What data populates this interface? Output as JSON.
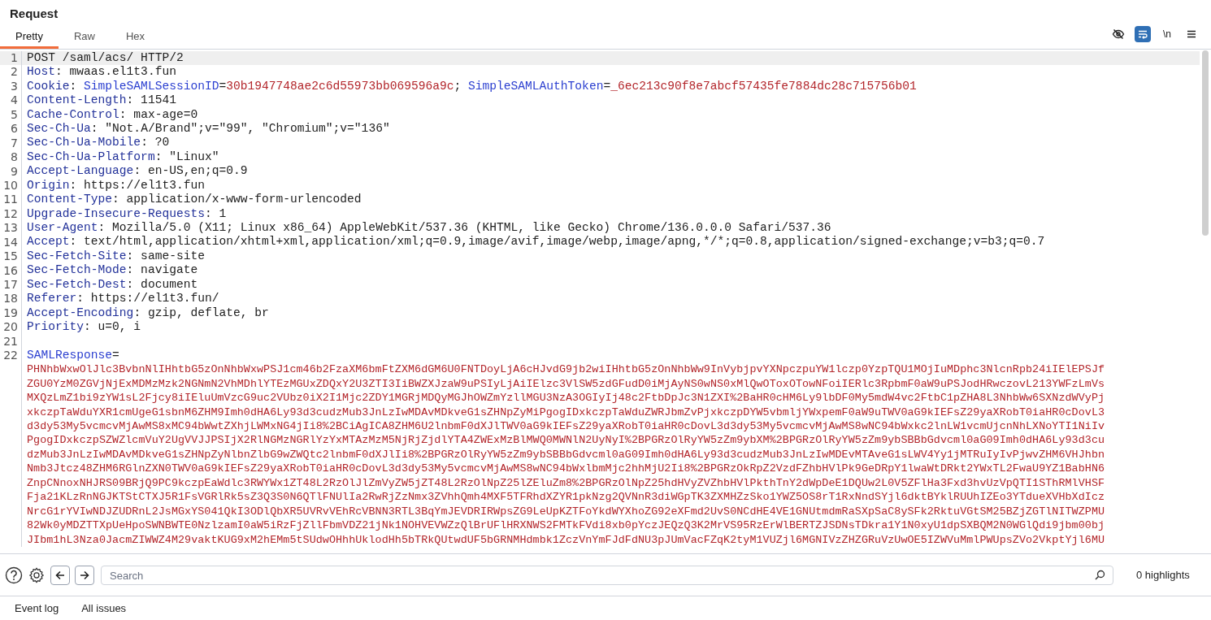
{
  "panel": {
    "title": "Request"
  },
  "tabs": [
    {
      "label": "Pretty",
      "selected": true
    },
    {
      "label": "Raw",
      "selected": false
    },
    {
      "label": "Hex",
      "selected": false
    }
  ],
  "toolbar": [
    {
      "kind": "hide",
      "selected": false
    },
    {
      "kind": "wrap",
      "selected": true
    },
    {
      "kind": "newline",
      "label": "\\n",
      "selected": false
    },
    {
      "kind": "menu",
      "selected": false
    }
  ],
  "editor": {
    "lines": [
      {
        "number": "1",
        "selected": true,
        "segments": [
          {
            "kind": "plain",
            "text": "POST /saml/acs/ HTTP/2"
          }
        ]
      },
      {
        "number": "2",
        "selected": false,
        "segments": [
          {
            "kind": "key",
            "text": "Host"
          },
          {
            "kind": "plain",
            "text": ": mwaas.el1t3.fun"
          }
        ]
      },
      {
        "number": "3",
        "selected": false,
        "segments": [
          {
            "kind": "key",
            "text": "Cookie"
          },
          {
            "kind": "plain",
            "text": ": "
          },
          {
            "kind": "cookie_name",
            "text": "SimpleSAMLSessionID"
          },
          {
            "kind": "plain",
            "text": "="
          },
          {
            "kind": "cookie_value",
            "text": "30b1947748ae2c6d55973bb069596a9c"
          },
          {
            "kind": "plain",
            "text": "; "
          },
          {
            "kind": "cookie_name",
            "text": "SimpleSAMLAuthToken"
          },
          {
            "kind": "plain",
            "text": "="
          },
          {
            "kind": "cookie_value",
            "text": "_6ec213c90f8e7abcf57435fe7884dc28c715756b01"
          }
        ]
      },
      {
        "number": "4",
        "selected": false,
        "segments": [
          {
            "kind": "key",
            "text": "Content-Length"
          },
          {
            "kind": "plain",
            "text": ": 11541"
          }
        ]
      },
      {
        "number": "5",
        "selected": false,
        "segments": [
          {
            "kind": "key",
            "text": "Cache-Control"
          },
          {
            "kind": "plain",
            "text": ": max-age=0"
          }
        ]
      },
      {
        "number": "6",
        "selected": false,
        "segments": [
          {
            "kind": "key",
            "text": "Sec-Ch-Ua"
          },
          {
            "kind": "plain",
            "text": ": \"Not.A/Brand\";v=\"99\", \"Chromium\";v=\"136\""
          }
        ]
      },
      {
        "number": "7",
        "selected": false,
        "segments": [
          {
            "kind": "key",
            "text": "Sec-Ch-Ua-Mobile"
          },
          {
            "kind": "plain",
            "text": ": ?0"
          }
        ]
      },
      {
        "number": "8",
        "selected": false,
        "segments": [
          {
            "kind": "key",
            "text": "Sec-Ch-Ua-Platform"
          },
          {
            "kind": "plain",
            "text": ": \"Linux\""
          }
        ]
      },
      {
        "number": "9",
        "selected": false,
        "segments": [
          {
            "kind": "key",
            "text": "Accept-Language"
          },
          {
            "kind": "plain",
            "text": ": en-US,en;q=0.9"
          }
        ]
      },
      {
        "number": "10",
        "selected": false,
        "segments": [
          {
            "kind": "key",
            "text": "Origin"
          },
          {
            "kind": "plain",
            "text": ": https://el1t3.fun"
          }
        ]
      },
      {
        "number": "11",
        "selected": false,
        "segments": [
          {
            "kind": "key",
            "text": "Content-Type"
          },
          {
            "kind": "plain",
            "text": ": application/x-www-form-urlencoded"
          }
        ]
      },
      {
        "number": "12",
        "selected": false,
        "segments": [
          {
            "kind": "key",
            "text": "Upgrade-Insecure-Requests"
          },
          {
            "kind": "plain",
            "text": ": 1"
          }
        ]
      },
      {
        "number": "13",
        "selected": false,
        "segments": [
          {
            "kind": "key",
            "text": "User-Agent"
          },
          {
            "kind": "plain",
            "text": ": Mozilla/5.0 (X11; Linux x86_64) AppleWebKit/537.36 (KHTML, like Gecko) Chrome/136.0.0.0 Safari/537.36"
          }
        ]
      },
      {
        "number": "14",
        "selected": false,
        "segments": [
          {
            "kind": "key",
            "text": "Accept"
          },
          {
            "kind": "plain",
            "text": ": text/html,application/xhtml+xml,application/xml;q=0.9,image/avif,image/webp,image/apng,*/*;q=0.8,application/signed-exchange;v=b3;q=0.7"
          }
        ]
      },
      {
        "number": "15",
        "selected": false,
        "segments": [
          {
            "kind": "key",
            "text": "Sec-Fetch-Site"
          },
          {
            "kind": "plain",
            "text": ": same-site"
          }
        ]
      },
      {
        "number": "16",
        "selected": false,
        "segments": [
          {
            "kind": "key",
            "text": "Sec-Fetch-Mode"
          },
          {
            "kind": "plain",
            "text": ": navigate"
          }
        ]
      },
      {
        "number": "17",
        "selected": false,
        "segments": [
          {
            "kind": "key",
            "text": "Sec-Fetch-Dest"
          },
          {
            "kind": "plain",
            "text": ": document"
          }
        ]
      },
      {
        "number": "18",
        "selected": false,
        "segments": [
          {
            "kind": "key",
            "text": "Referer"
          },
          {
            "kind": "plain",
            "text": ": https://el1t3.fun/"
          }
        ]
      },
      {
        "number": "19",
        "selected": false,
        "segments": [
          {
            "kind": "key",
            "text": "Accept-Encoding"
          },
          {
            "kind": "plain",
            "text": ": gzip, deflate, br"
          }
        ]
      },
      {
        "number": "20",
        "selected": false,
        "segments": [
          {
            "kind": "key",
            "text": "Priority"
          },
          {
            "kind": "plain",
            "text": ": u=0, i"
          }
        ]
      },
      {
        "number": "21",
        "selected": false
      },
      {
        "number": "22",
        "selected": false,
        "segments": [
          {
            "kind": "param_name",
            "text": "SAMLResponse"
          },
          {
            "kind": "plain",
            "text": "="
          }
        ],
        "wrapped": [
          "PHNhbWxwOlJlc3BvbnNlIHhtbG5zOnNhbWxwPSJ1cm46b2FzaXM6bmFtZXM6dGM6U0FNTDoyLjA6cHJvdG9jb2wiIHhtbG5zOnNhbWw9InVybjpvYXNpczpuYW1lczp0YzpTQU1MOjIuMDphc3NlcnRpb24iIElEPSJf",
          "ZGU0YzM0ZGVjNjExMDMzMzk2NGNmN2VhMDhlYTEzMGUxZDQxY2U3ZTI3IiBWZXJzaW9uPSIyLjAiIElzc3VlSW5zdGFudD0iMjAyNS0wNS0xMlQwOToxOTowNFoiIERlc3RpbmF0aW9uPSJodHRwczovL213YWFzLmVs",
          "MXQzLmZ1bi9zYW1sL2Fjcy8iIEluUmVzcG9uc2VUbz0iX2I1Mjc2ZDY1MGRjMDQyMGJhOWZmYzllMGU3NzA3OGIyIj48c2FtbDpJc3N1ZXI%2BaHR0cHM6Ly9lbDF0My5mdW4vc2FtbC1pZHA8L3NhbWw6SXNzdWVyPj",
          "xkczpTaWduYXR1cmUgeG1sbnM6ZHM9Imh0dHA6Ly93d3cudzMub3JnLzIwMDAvMDkveG1sZHNpZyMiPgogIDxkczpTaWduZWRJbmZvPjxkczpDYW5vbmljYWxpemF0aW9uTWV0aG9kIEFsZ29yaXRobT0iaHR0cDovL3",
          "d3dy53My5vcmcvMjAwMS8xMC94bWwtZXhjLWMxNG4jIi8%2BCiAgICA8ZHM6U2lnbmF0dXJlTWV0aG9kIEFsZ29yaXRobT0iaHR0cDovL3d3dy53My5vcmcvMjAwMS8wNC94bWxkc2lnLW1vcmUjcnNhLXNoYTI1NiIv",
          "PgogIDxkczpSZWZlcmVuY2UgVVJJPSIjX2RlNGMzNGRlYzYxMTAzMzM5NjRjZjdlYTA4ZWExMzBlMWQ0MWNlN2UyNyI%2BPGRzOlRyYW5zZm9ybXM%2BPGRzOlRyYW5zZm9ybSBBbGdvcml0aG09Imh0dHA6Ly93d3cu",
          "dzMub3JnLzIwMDAvMDkveG1sZHNpZyNlbnZlbG9wZWQtc2lnbmF0dXJlIi8%2BPGRzOlRyYW5zZm9ybSBBbGdvcml0aG09Imh0dHA6Ly93d3cudzMub3JnLzIwMDEvMTAveG1sLWV4Yy1jMTRuIyIvPjwvZHM6VHJhbn",
          "Nmb3Jtcz48ZHM6RGlnZXN0TWV0aG9kIEFsZ29yaXRobT0iaHR0cDovL3d3dy53My5vcmcvMjAwMS8wNC94bWxlbmMjc2hhMjU2Ii8%2BPGRzOkRpZ2VzdFZhbHVlPk9GeDRpY1lwaWtDRkt2YWxTL2FwaU9YZ1BabHN6",
          "ZnpCNnoxNHJRS09BRjQ9PC9kczpEaWdlc3RWYWx1ZT48L2RzOlJlZmVyZW5jZT48L2RzOlNpZ25lZEluZm8%2BPGRzOlNpZ25hdHVyZVZhbHVlPkthTnY2dWpDeE1DQUw2L0V5ZFlHa3Fxd3hvUzVpQTI1SThRMlVHSF",
          "Fja21KLzRnNGJKTStCTXJ5R1FsVGRlRk5sZ3Q3S0N6QTlFNUlIa2RwRjZzNmx3ZVhhQmh4MXF5TFRhdXZYR1pkNzg2QVNnR3diWGpTK3ZXMHZzSko1YWZ5OS8rT1RxNndSYjl6dktBYklRUUhIZEo3YTdueXVHbXdIcz",
          "NrcG1rYVIwNDJZUDRnL2JsMGxYS041QkI3ODlQbXR5UVRvVEhRcVBNN3RTL3BqYmJEVDRIRWpsZG9LeUpKZTFoYkdWYXhoZG92eXFmd2UvS0NCdHE4VE1GNUtmdmRaSXpSaC8ySFk2RktuVGtSM25BZjZGTlNITWZPMU",
          "82Wk0yMDZTTXpUeHpoSWNBWTE0NzlzamI0aW5iRzFjZllFbmVDZ21jNk1NOHVEVWZzQlBrUFlHRXNWS2FMTkFVdi8xb0pYczJEQzQ3K2MrVS95RzErWlBERTZJSDNsTDkra1Y1N0xyU1dpSXBQM2N0WGlQdi9jbm00bj",
          "JIbm1hL3Nza0JacmZIWWZ4M29vaktKUG9xM2hEMm5tSUdwOHhhUklodHh5bTRkQUtwdUF5bGRNMHdmbk1ZczVnYmFJdFdNU3pJUmVacFZqK2tyM1VUZjl6MGNIVzZHZGRuVzUwOE5IZWVuMmlPWUpsZVo2VkptYjl6MU"
        ]
      }
    ]
  },
  "search": {
    "placeholder": "Search",
    "highlights": "0 highlights"
  },
  "bottom_tabs": [
    {
      "label": "Event log"
    },
    {
      "label": "All issues"
    }
  ]
}
